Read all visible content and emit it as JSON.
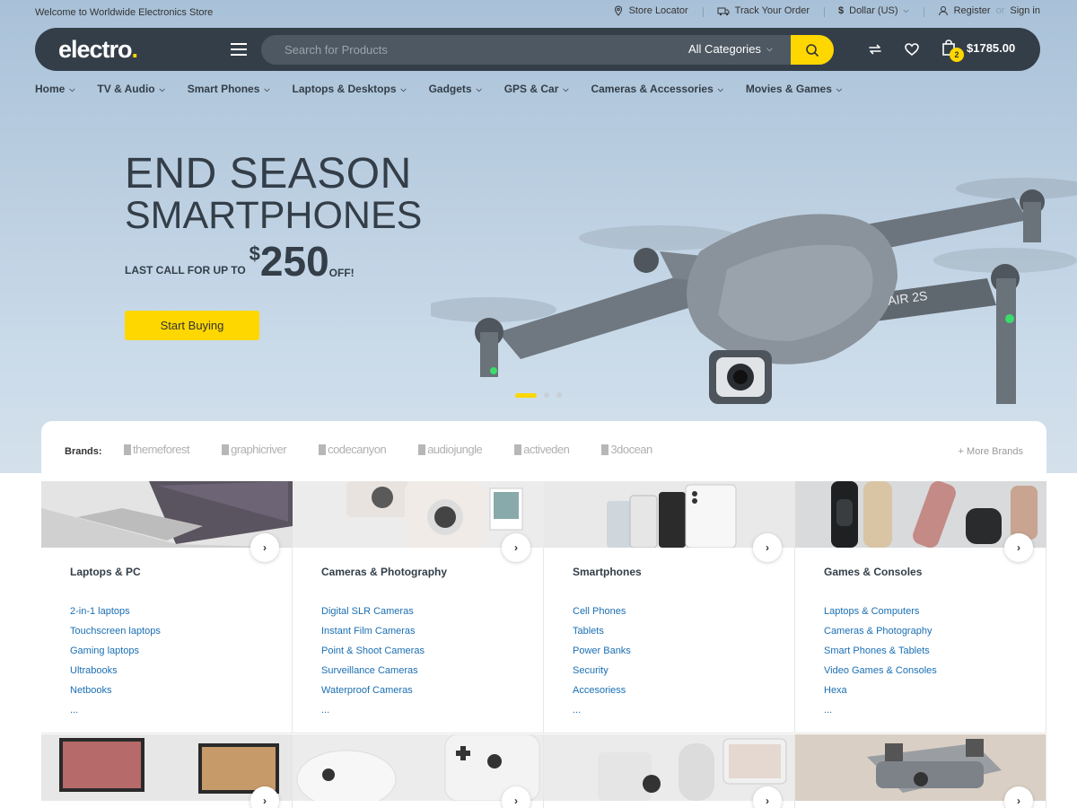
{
  "topbar": {
    "welcome": "Welcome to Worldwide Electronics Store",
    "store_locator": "Store Locator",
    "track_order": "Track Your Order",
    "currency": "Dollar (US)",
    "register": "Register",
    "or": "or",
    "sign_in": "Sign in"
  },
  "header": {
    "logo": "electro",
    "logo_dot": ".",
    "search_placeholder": "Search for Products",
    "category": "All Categories",
    "cart_count": "2",
    "cart_total": "$1785.00"
  },
  "nav": [
    {
      "label": "Home"
    },
    {
      "label": "TV & Audio"
    },
    {
      "label": "Smart Phones"
    },
    {
      "label": "Laptops & Desktops"
    },
    {
      "label": "Gadgets"
    },
    {
      "label": "GPS & Car"
    },
    {
      "label": "Cameras & Accessories"
    },
    {
      "label": "Movies & Games"
    }
  ],
  "hero": {
    "title1": "END SEASON",
    "title2": "SMARTPHONES",
    "last_call": "LAST CALL FOR UP TO",
    "currency": "$",
    "amount": "250",
    "off": "OFF!",
    "button": "Start Buying",
    "drone_label": "AIR 2S",
    "slide_count": 3,
    "active_slide": 1
  },
  "brands": {
    "label": "Brands:",
    "items": [
      "themeforest",
      "graphicriver",
      "codecanyon",
      "audiojungle",
      "activeden",
      "3docean"
    ],
    "more": "+ More Brands"
  },
  "categories": [
    {
      "title": "Laptops & PC",
      "links": [
        "2-in-1 laptops",
        "Touchscreen laptops",
        "Gaming laptops",
        "Ultrabooks",
        "Netbooks",
        "..."
      ]
    },
    {
      "title": "Cameras & Photography",
      "links": [
        "Digital SLR Cameras",
        "Instant Film Cameras",
        "Point & Shoot Cameras",
        "Surveillance Cameras",
        "Waterproof Cameras",
        "..."
      ]
    },
    {
      "title": "Smartphones",
      "links": [
        "Cell Phones",
        "Tablets",
        "Power Banks",
        "Security",
        "Accesoriess",
        "..."
      ]
    },
    {
      "title": "Games & Consoles",
      "links": [
        "Laptops & Computers",
        "Cameras & Photography",
        "Smart Phones & Tablets",
        "Video Games & Consoles",
        "Hexa",
        "..."
      ]
    }
  ],
  "colors": {
    "accent": "#fed700",
    "dark": "#333e48",
    "link": "#1a6fb3"
  }
}
